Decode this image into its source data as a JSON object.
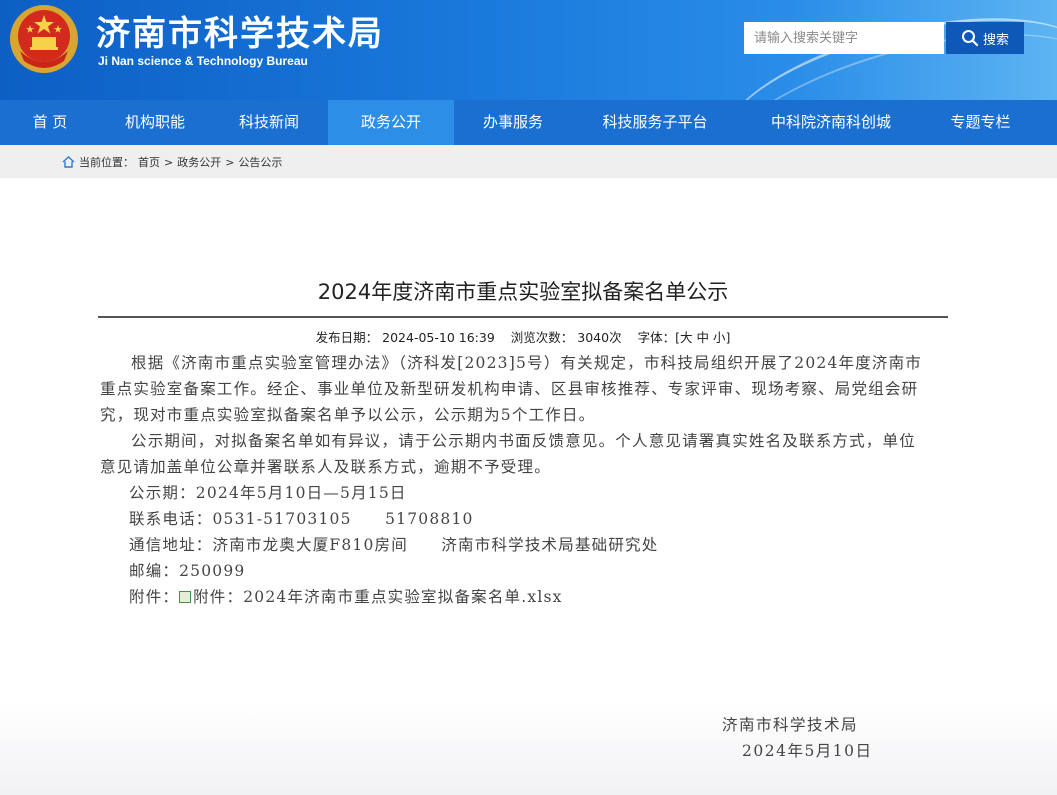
{
  "header": {
    "title": "济南市科学技术局",
    "subtitle": "Ji Nan science & Technology Bureau",
    "search_placeholder": "请输入搜索关键字",
    "search_button": "搜索"
  },
  "nav": {
    "items": [
      {
        "label": "首 页"
      },
      {
        "label": "机构职能"
      },
      {
        "label": "科技新闻"
      },
      {
        "label": "政务公开",
        "active": true
      },
      {
        "label": "办事服务"
      },
      {
        "label": "科技服务子平台"
      },
      {
        "label": "中科院济南科创城"
      },
      {
        "label": "专题专栏"
      }
    ]
  },
  "breadcrumb": {
    "prefix": "当前位置：",
    "home": "首页",
    "sep": ">",
    "section": "政务公开",
    "current": "公告公示"
  },
  "article": {
    "title": "2024年度济南市重点实验室拟备案名单公示",
    "meta": {
      "publish_label": "发布日期：",
      "publish_date": "2024-05-10 16:39",
      "views_label": "浏览次数：",
      "views": "3040次",
      "font_label": "字体：[",
      "font_large": "大",
      "font_medium": "中",
      "font_small": "小",
      "font_close": "]"
    },
    "para1": "根据《济南市重点实验室管理办法》（济科发[2023]5号）有关规定，市科技局组织开展了2024年度济南市重点实验室备案工作。经企、事业单位及新型研发机构申请、区县审核推荐、专家评审、现场考察、局党组会研究，现对市重点实验室拟备案名单予以公示，公示期为5个工作日。",
    "para2": "公示期间，对拟备案名单如有异议，请于公示期内书面反馈意见。个人意见请署真实姓名及联系方式，单位意见请加盖单位公章并署联系人及联系方式，逾期不予受理。",
    "period": "公示期：2024年5月10日—5月15日",
    "phone": "联系电话：0531-51703105　　51708810",
    "address": "通信地址：济南市龙奥大厦F810房间　　济南市科学技术局基础研究处",
    "postcode": "邮编：250099",
    "attachment_label": "附件：",
    "attachment_link": "附件：2024年济南市重点实验室拟备案名单.xlsx",
    "signature_org": "济南市科学技术局",
    "signature_date": "2024年5月10日"
  },
  "colors": {
    "header_blue": "#1a79dc",
    "nav_blue": "#1a6fd0",
    "nav_active": "#2d8ee8",
    "search_button": "#0e58b8"
  }
}
